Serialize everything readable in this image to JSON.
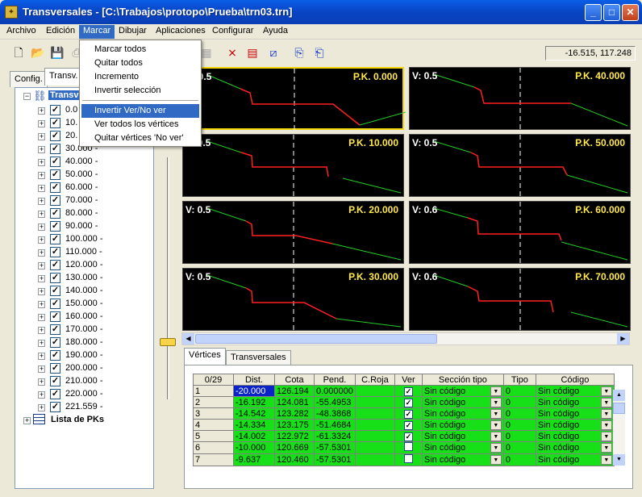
{
  "window": {
    "title": "Transversales - [C:\\Trabajos\\protopo\\Prueba\\trn03.trn]",
    "app_icon": "app-icon"
  },
  "menu": [
    "Archivo",
    "Edición",
    "Marcar",
    "Dibujar",
    "Aplicaciones",
    "Configurar",
    "Ayuda"
  ],
  "dropdown": {
    "items": [
      "Marcar todos",
      "Quitar todos",
      "Incremento",
      "Invertir selección",
      "Invertir Ver/No ver",
      "Ver todos los vértices",
      "Quitar vértices 'No ver'"
    ],
    "highlighted": 4
  },
  "coords": "-16.515, 117.248",
  "left_tabs": [
    "Config.",
    "Transv."
  ],
  "tree": {
    "root": "Transversales",
    "items": [
      "0.0",
      "10.",
      "20.",
      "30.000 -",
      "40.000 -",
      "50.000 -",
      "60.000 -",
      "70.000 -",
      "80.000 -",
      "90.000 -",
      "100.000 -",
      "110.000 -",
      "120.000 -",
      "130.000 -",
      "140.000 -",
      "150.000 -",
      "160.000 -",
      "170.000 -",
      "180.000 -",
      "190.000 -",
      "200.000 -",
      "210.000 -",
      "220.000 -",
      "221.559 -"
    ],
    "footer": "Lista de PKs"
  },
  "panels": [
    {
      "v": "V: 0.5",
      "pk": "P.K. 0.000"
    },
    {
      "v": "V: 0.5",
      "pk": "P.K. 40.000"
    },
    {
      "v": "V: 0.5",
      "pk": "P.K. 10.000"
    },
    {
      "v": "V: 0.5",
      "pk": "P.K. 50.000"
    },
    {
      "v": "V: 0.5",
      "pk": "P.K. 20.000"
    },
    {
      "v": "V: 0.6",
      "pk": "P.K. 60.000"
    },
    {
      "v": "V: 0.5",
      "pk": "P.K. 30.000"
    },
    {
      "v": "V: 0.6",
      "pk": "P.K. 70.000"
    }
  ],
  "bottom_tabs": [
    "Vértices",
    "Transversales"
  ],
  "grid": {
    "corner": "0/29",
    "headers": [
      "Dist.",
      "Cota",
      "Pend.",
      "C.Roja",
      "Ver",
      "Sección tipo",
      "Tipo",
      "Código"
    ],
    "rows": [
      {
        "n": "1",
        "dist": "-20.000",
        "cota": "126.194",
        "pend": "0.000000",
        "ver": true,
        "sec": "Sin código",
        "tipo": "0",
        "cod": "Sin código"
      },
      {
        "n": "2",
        "dist": "-16.192",
        "cota": "124.081",
        "pend": "-55.4953",
        "ver": true,
        "sec": "Sin código",
        "tipo": "0",
        "cod": "Sin código"
      },
      {
        "n": "3",
        "dist": "-14.542",
        "cota": "123.282",
        "pend": "-48.3868",
        "ver": true,
        "sec": "Sin código",
        "tipo": "0",
        "cod": "Sin código"
      },
      {
        "n": "4",
        "dist": "-14.334",
        "cota": "123.175",
        "pend": "-51.4684",
        "ver": true,
        "sec": "Sin código",
        "tipo": "0",
        "cod": "Sin código"
      },
      {
        "n": "5",
        "dist": "-14.002",
        "cota": "122.972",
        "pend": "-61.3324",
        "ver": true,
        "sec": "Sin código",
        "tipo": "0",
        "cod": "Sin código"
      },
      {
        "n": "6",
        "dist": "-10.000",
        "cota": "120.669",
        "pend": "-57.5301",
        "ver": false,
        "sec": "Sin código",
        "tipo": "0",
        "cod": "Sin código"
      },
      {
        "n": "7",
        "dist": "-9.637",
        "cota": "120.460",
        "pend": "-57.5301",
        "ver": false,
        "sec": "Sin código",
        "tipo": "0",
        "cod": "Sin código"
      }
    ]
  }
}
